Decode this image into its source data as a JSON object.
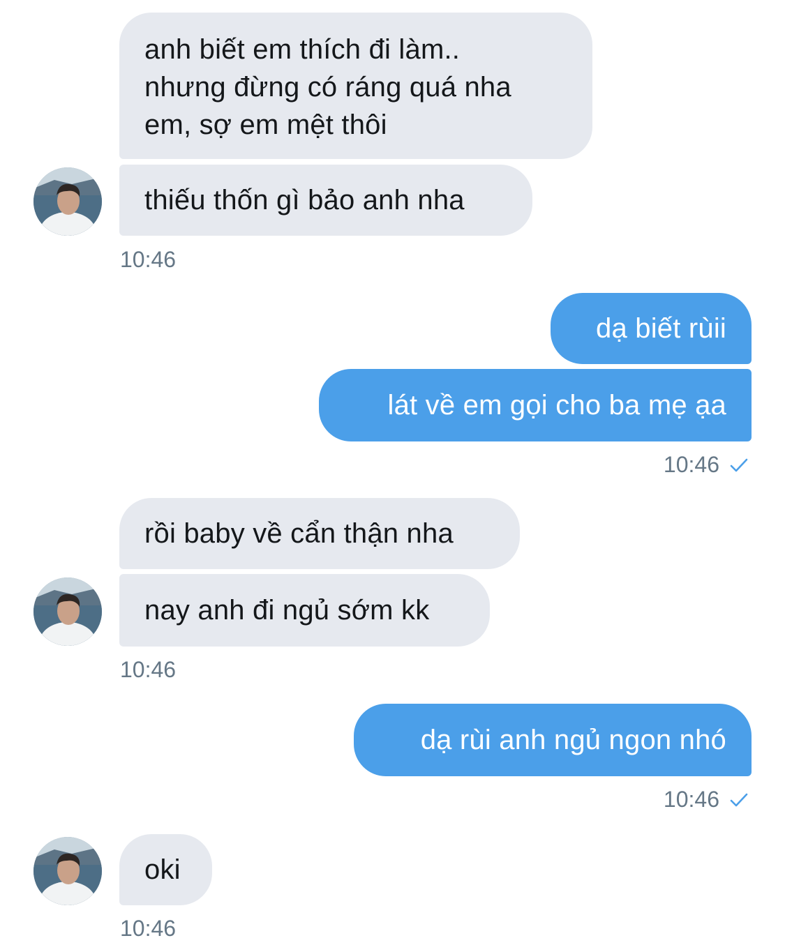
{
  "conversation": {
    "m1": "anh biết em thích đi làm..\nnhưng đừng có ráng quá nha\nem, sợ em mệt thôi",
    "m2": "thiếu thốn gì bảo anh nha",
    "t1": "10:46",
    "m3": "dạ biết rùii",
    "m4": "lát về em gọi cho ba mẹ ạa",
    "t2": "10:46",
    "m5": "rồi baby về cẩn thận nha",
    "m6": "nay anh đi ngủ sớm kk",
    "t3": "10:46",
    "m7": "dạ rùi anh ngủ ngon nhó",
    "t4": "10:46",
    "m8": "oki",
    "t5": "10:46"
  },
  "colors": {
    "incoming_bubble": "#e6e9ef",
    "outgoing_bubble": "#4b9fe9",
    "timestamp": "#657786",
    "read_check": "#4b9fe9"
  },
  "icons": {
    "read_receipt": "check-icon",
    "contact_avatar": "avatar"
  }
}
